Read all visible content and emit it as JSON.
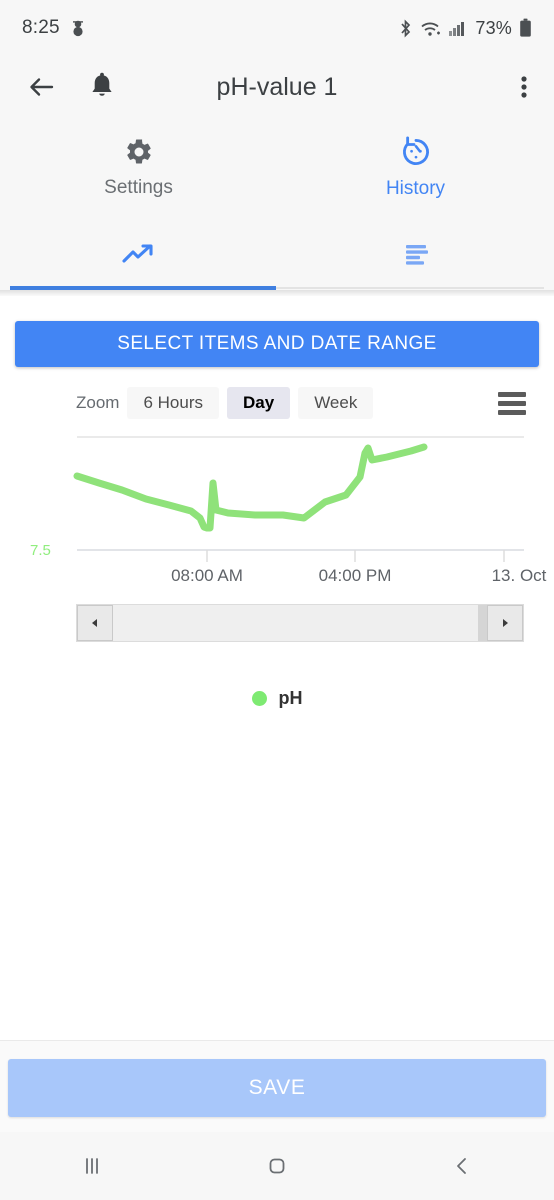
{
  "status_bar": {
    "time": "8:25",
    "left_icon": "snowman-icon",
    "bluetooth_icon": "bluetooth-icon",
    "wifi_icon": "wifi-icon",
    "signal_icon": "cellular-signal-icon",
    "battery_percent": "73%",
    "battery_icon": "battery-icon"
  },
  "app_bar": {
    "back_icon": "arrow-left-icon",
    "bell_icon": "bell-icon",
    "title": "pH-value 1",
    "overflow_icon": "more-vertical-icon"
  },
  "primary_tabs": [
    {
      "label": "Settings",
      "icon": "gear-icon",
      "active": false
    },
    {
      "label": "History",
      "icon": "history-icon",
      "active": true
    }
  ],
  "secondary_tabs": [
    {
      "label": "",
      "icon": "trending-up-icon",
      "active": true
    },
    {
      "label": "",
      "icon": "list-sort-icon",
      "active": false
    }
  ],
  "main": {
    "select_button_label": "SELECT ITEMS AND DATE RANGE",
    "zoom_label": "Zoom",
    "zoom_options": [
      {
        "label": "6 Hours",
        "selected": false
      },
      {
        "label": "Day",
        "selected": true
      },
      {
        "label": "Week",
        "selected": false
      }
    ],
    "chart_menu_icon": "hamburger-menu-icon",
    "navigator": {
      "left_arrow_icon": "triangle-left-icon",
      "right_arrow_icon": "triangle-right-icon"
    },
    "legend": [
      {
        "label": "pH",
        "color": "#7eea72"
      }
    ]
  },
  "chart_data": {
    "type": "line",
    "title": "",
    "xlabel": "",
    "ylabel": "",
    "grid": true,
    "legend_position": "bottom",
    "series": [
      {
        "name": "pH",
        "color": "#8fe27a",
        "points": [
          {
            "x": 0.0,
            "y": 7.83
          },
          {
            "x": 0.05,
            "y": 7.8
          },
          {
            "x": 0.1,
            "y": 7.78
          },
          {
            "x": 0.16,
            "y": 7.74
          },
          {
            "x": 0.22,
            "y": 7.71
          },
          {
            "x": 0.28,
            "y": 7.7
          },
          {
            "x": 0.33,
            "y": 7.68
          },
          {
            "x": 0.36,
            "y": 7.65
          },
          {
            "x": 0.355,
            "y": 7.63
          },
          {
            "x": 0.365,
            "y": 7.63
          },
          {
            "x": 0.375,
            "y": 7.81
          },
          {
            "x": 0.385,
            "y": 7.72
          },
          {
            "x": 0.42,
            "y": 7.7
          },
          {
            "x": 0.5,
            "y": 7.69
          },
          {
            "x": 0.58,
            "y": 7.69
          },
          {
            "x": 0.64,
            "y": 7.68
          },
          {
            "x": 0.7,
            "y": 7.73
          },
          {
            "x": 0.76,
            "y": 7.75
          },
          {
            "x": 0.8,
            "y": 7.8
          },
          {
            "x": 0.815,
            "y": 7.89
          },
          {
            "x": 0.818,
            "y": 7.96
          },
          {
            "x": 0.828,
            "y": 7.92
          },
          {
            "x": 0.87,
            "y": 7.93
          },
          {
            "x": 0.94,
            "y": 7.95
          },
          {
            "x": 1.0,
            "y": 7.97
          }
        ]
      }
    ],
    "y_ticks": [
      {
        "value": 7.5,
        "label": "7.5"
      }
    ],
    "ylim": [
      7.5,
      8.0
    ],
    "x_ticks": [
      {
        "pos": 0.3,
        "label": "08:00 AM"
      },
      {
        "pos": 0.73,
        "label": "04:00 PM"
      },
      {
        "pos": 1.0,
        "label": "13. Oct"
      }
    ]
  },
  "footer": {
    "save_label": "SAVE"
  },
  "android_nav": [
    {
      "icon": "recents-icon"
    },
    {
      "icon": "home-icon"
    },
    {
      "icon": "back-icon"
    }
  ],
  "colors": {
    "accent_blue": "#4285f4",
    "save_blue": "#a8c7fa",
    "series_green": "#8fe27a",
    "panel_gray": "#f7f7f7"
  }
}
